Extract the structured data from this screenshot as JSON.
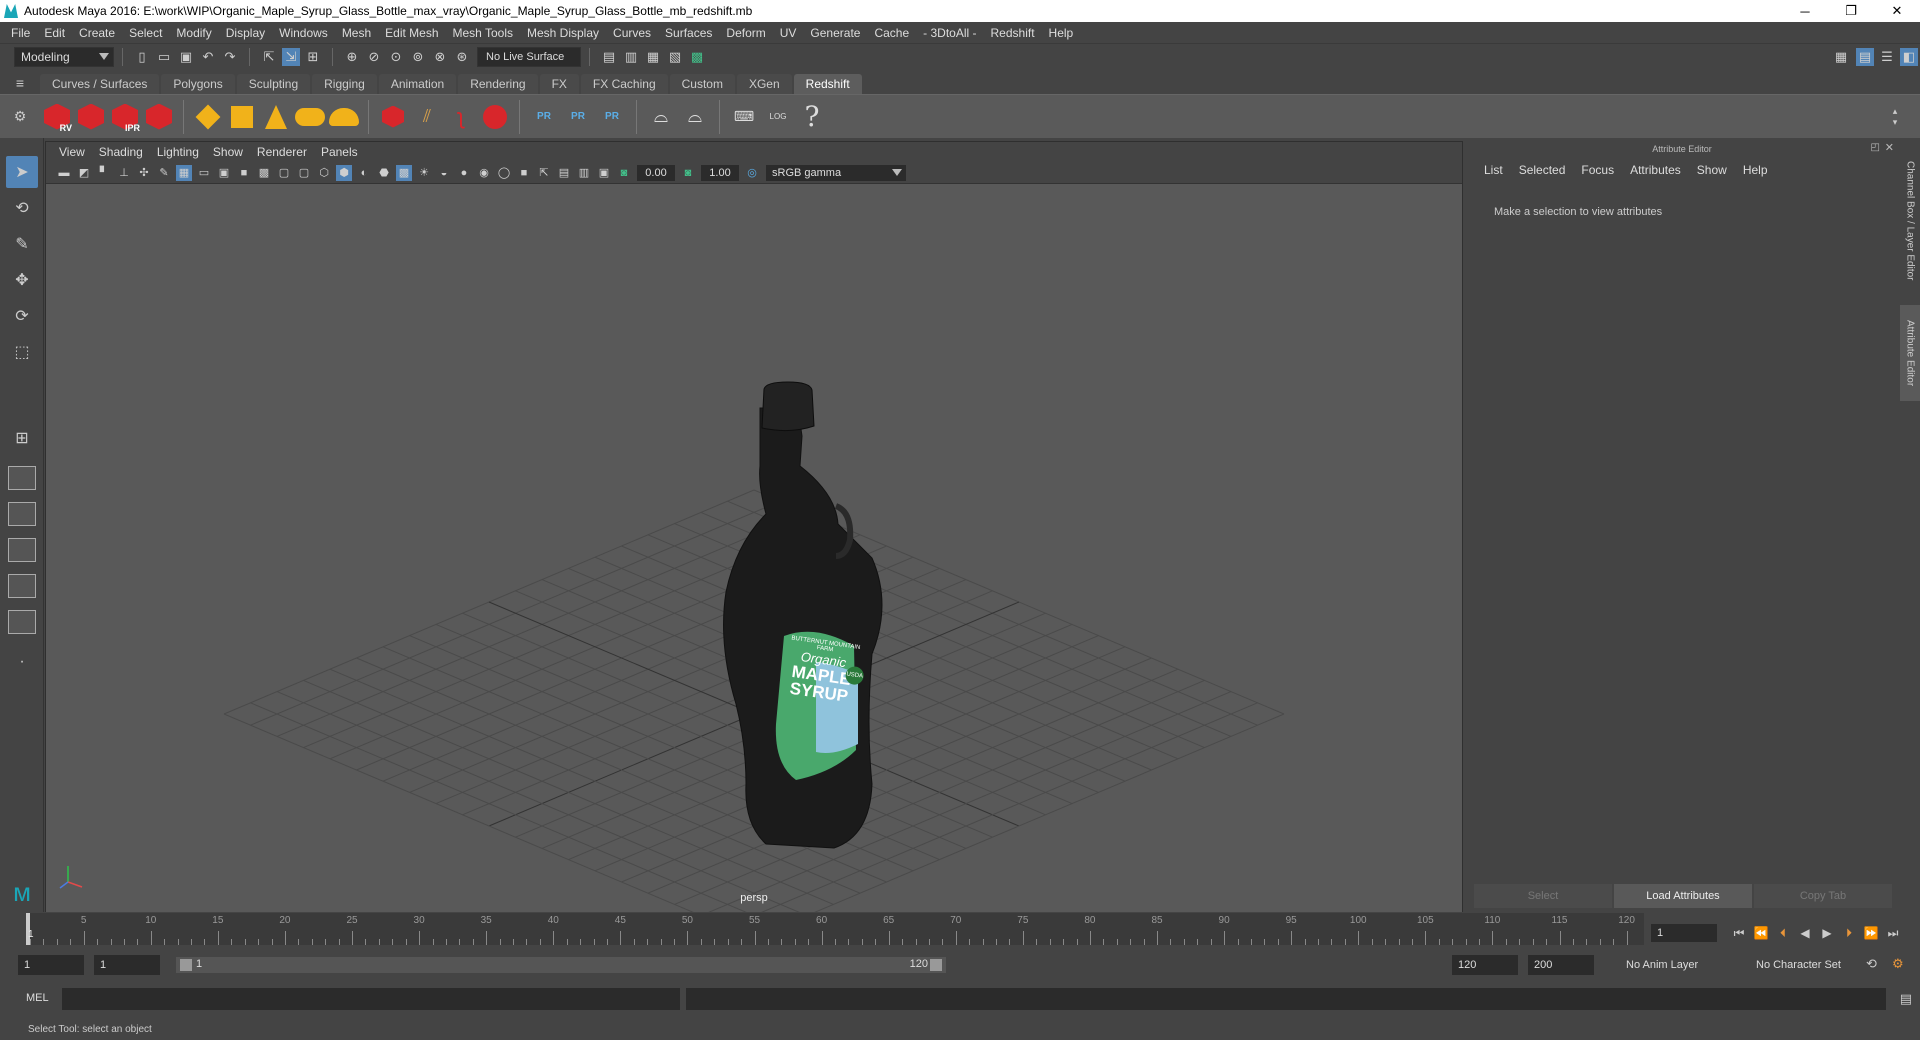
{
  "window": {
    "title": "Autodesk Maya 2016: E:\\work\\WIP\\Organic_Maple_Syrup_Glass_Bottle_max_vray\\Organic_Maple_Syrup_Glass_Bottle_mb_redshift.mb",
    "minimize": "─",
    "restore": "❐",
    "close": "✕"
  },
  "menubar": [
    "File",
    "Edit",
    "Create",
    "Select",
    "Modify",
    "Display",
    "Windows",
    "Mesh",
    "Edit Mesh",
    "Mesh Tools",
    "Mesh Display",
    "Curves",
    "Surfaces",
    "Deform",
    "UV",
    "Generate",
    "Cache",
    "- 3DtoAll -",
    "Redshift",
    "Help"
  ],
  "statusline": {
    "mode": "Modeling",
    "live_surface": "No Live Surface"
  },
  "shelf_tabs": [
    "Curves / Surfaces",
    "Polygons",
    "Sculpting",
    "Rigging",
    "Animation",
    "Rendering",
    "FX",
    "FX Caching",
    "Custom",
    "XGen",
    "Redshift"
  ],
  "shelf_active_tab": "Redshift",
  "shelf_labels": {
    "rv": "RV",
    "ipr": "IPR",
    "pr": "PR",
    "log": "LOG",
    "help": "?"
  },
  "panel": {
    "menu": [
      "View",
      "Shading",
      "Lighting",
      "Show",
      "Renderer",
      "Panels"
    ],
    "exposure": "0.00",
    "gamma": "1.00",
    "color_space": "sRGB gamma",
    "camera": "persp"
  },
  "bottle_label": {
    "brand": "BUTTERNUT MOUNTAIN FARM",
    "line1": "Organic",
    "line2": "MAPLE",
    "line3": "SYRUP",
    "badge": "USDA"
  },
  "attribute_editor": {
    "title": "Attribute Editor",
    "menu": [
      "List",
      "Selected",
      "Focus",
      "Attributes",
      "Show",
      "Help"
    ],
    "message": "Make a selection to view attributes",
    "buttons": {
      "select": "Select",
      "load": "Load Attributes",
      "copy": "Copy Tab"
    }
  },
  "side_tabs": {
    "channel_box": "Channel Box / Layer Editor",
    "attribute_editor": "Attribute Editor"
  },
  "timeline": {
    "labels": [
      "5",
      "10",
      "15",
      "20",
      "25",
      "30",
      "35",
      "40",
      "45",
      "50",
      "55",
      "60",
      "65",
      "70",
      "75",
      "80",
      "85",
      "90",
      "95",
      "100",
      "105",
      "110",
      "115",
      "120"
    ],
    "current_frame_marker": "1",
    "current_frame": "1"
  },
  "range": {
    "start": "1",
    "anim_start": "1",
    "slider_start": "1",
    "slider_end": "120",
    "anim_end": "120",
    "end": "200",
    "anim_layer": "No Anim Layer",
    "character_set": "No Character Set"
  },
  "cmdline": {
    "label": "MEL"
  },
  "helpline": "Select Tool: select an object",
  "colors": {
    "background": "#444444",
    "viewport": "#595959",
    "active_tool": "#5284b6",
    "redshift_red": "#d8262b",
    "shelf_yellow": "#f1b21a"
  }
}
